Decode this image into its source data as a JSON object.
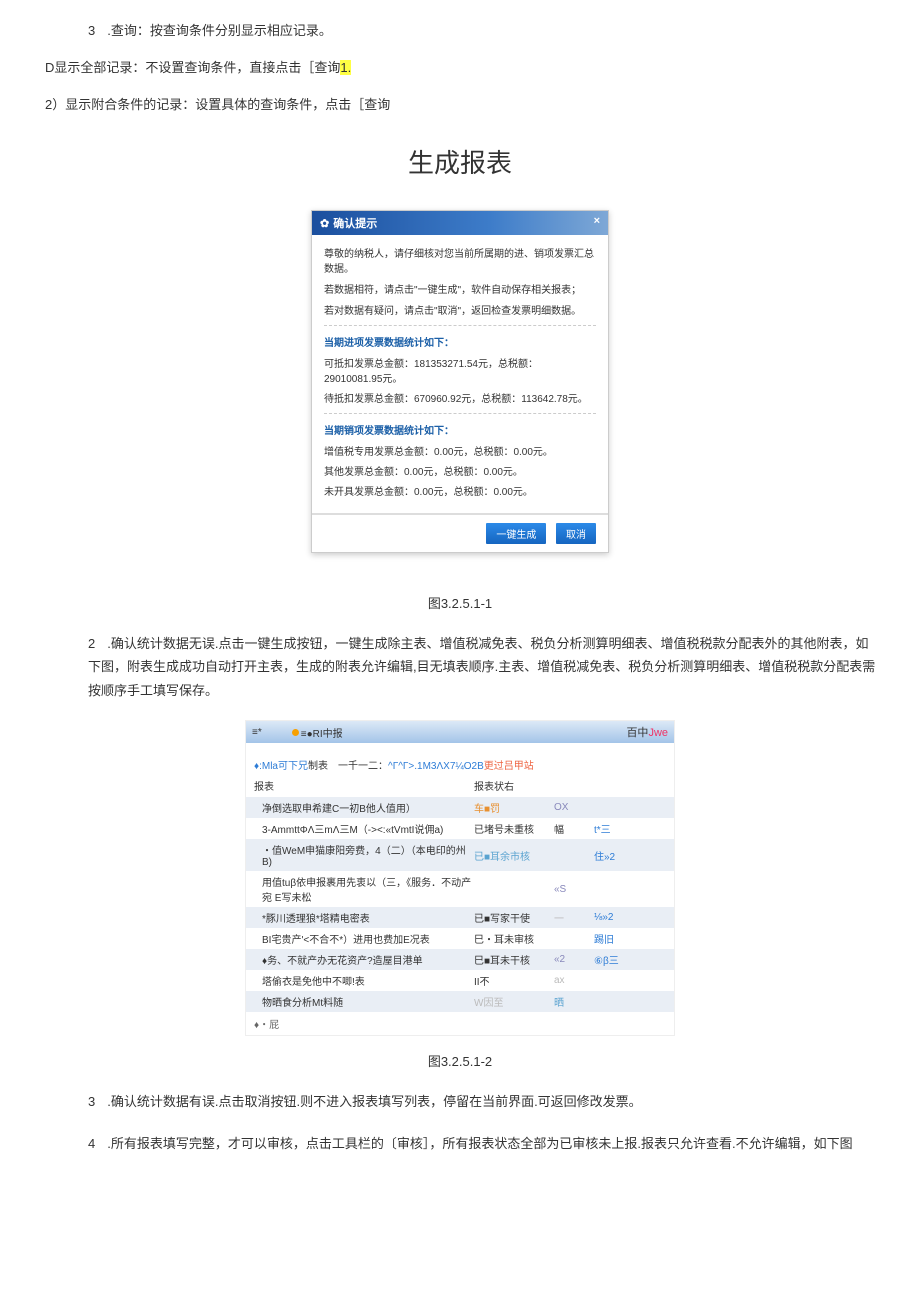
{
  "heading": {
    "item3_no": "3",
    "item3_text": ".查询：按查询条件分别显示相应记录。",
    "subD_a": "D显示全部记录：不设置查询条件，直接点击［查询",
    "subD_hl": "1.",
    "sub2": "2）显示附合条件的记录：设置具体的查询条件，点击［查询"
  },
  "title_gen": "生成报表",
  "dialog": {
    "header_title": "确认提示",
    "header_close": "×",
    "intro1": "尊敬的纳税人，请仔细核对您当前所属期的进、销项发票汇总数据。",
    "intro2": "若数据相符，请点击\"一键生成\"，软件自动保存相关报表；",
    "intro3": "若对数据有疑问，请点击\"取消\"，返回检查发票明细数据。",
    "sec1_h": "当期进项发票数据统计如下：",
    "sec1_l1": "可抵扣发票总金额：181353271.54元，总税额：29010081.95元。",
    "sec1_l2": "待抵扣发票总金额：670960.92元，总税额：113642.78元。",
    "sec2_h": "当期销项发票数据统计如下：",
    "sec2_l1": "增值税专用发票总金额：0.00元，总税额：0.00元。",
    "sec2_l2": "其他发票总金额：0.00元，总税额：0.00元。",
    "sec2_l3": "未开具发票总金额：0.00元，总税额：0.00元。",
    "btn_gen": "一键生成",
    "btn_cancel": "取消"
  },
  "cap1": "图3.2.5.1-1",
  "para2_no": "2",
  "para2_text": ".确认统计数据无误.点击一键生成按钮，一键生成除主表、增值税减免表、税负分析测算明细表、增值税税款分配表外的其他附表，如下图，附表生成成功自动打开主表，生成的附表允许编辑,目无填表顺序.主表、增值税减免表、税负分析测算明细表、增值税税款分配表需按顺序手工填写保存。",
  "table": {
    "header_left": "≡*",
    "header_mid": "≡●RI中报",
    "header_jwe_pre": "百中",
    "header_jwe": "Jwe",
    "sub_a": "♦:Mla可下兄",
    "sub_b": "制表　一千一二：",
    "sub_c": "^Γ^Γ>.1M3ΛX7¼O2B",
    "sub_d": "更过吕甲站",
    "head_c1": "报表",
    "head_c2": "报表状右",
    "rows": [
      {
        "c1": "净倒选取申希建C一初B他人值用）",
        "c2": "车■罚",
        "c2cls": "orange",
        "c3": "OX",
        "c3cls": "violet",
        "c4": "",
        "alt": true
      },
      {
        "c1": "3-AmmttΦΛ三mΛ三M（-><:«tVmtI说佣a)",
        "c2": "已堵号未重核",
        "c3": "幅",
        "c4": "t*三",
        "c4cls": "ltblue"
      },
      {
        "c1": "・值WeM申猫康阳旁费，4（二）（本电印的州B)",
        "c2": "已■耳余市核",
        "c2cls": "ltblue",
        "c3": "",
        "c4": "住»2",
        "c4cls": "teal",
        "alt": true
      },
      {
        "c1": "用值tuβ依申报裹用先衷以（三，《服务．不动产宛 E写未松",
        "c2": "",
        "c3": "«S",
        "c3cls": "violet",
        "c4": ""
      },
      {
        "c1": "*豚川透理狼*塔精电密表",
        "c2": "已■写家干使",
        "c3": "一",
        "c3cls": "gray",
        "c4": "⅛»2",
        "c4cls": "pink",
        "alt": true
      },
      {
        "c1": "BI宅贵产'<不合不*）进用也费加E况表",
        "c2": "巳・耳未审核",
        "c3": "",
        "c4": "踢旧",
        "c4cls": "ltblue"
      },
      {
        "c1": "♦务、不就产办无花资产?造屋目港单",
        "c2": "巳■耳未干核",
        "c3": "«2",
        "c3cls": "violet",
        "c4": "⑥β三",
        "c4cls": "green",
        "alt": true
      },
      {
        "c1": "塔偷衣是免他中不唧!表",
        "c2": "II不",
        "c3": "ax",
        "c3cls": "gray",
        "c4": ""
      },
      {
        "c1": "物晒食分析Mt料随",
        "c2": "W因至",
        "c2cls": "gray",
        "c3": "晒",
        "c3cls": "ltblue",
        "c4": "",
        "alt": true
      }
    ],
    "foot": "♦・屁"
  },
  "cap2": "图3.2.5.1-2",
  "para3_no": "3",
  "para3_text": ".确认统计数据有误.点击取消按钮.则不进入报表填写列表，停留在当前界面.可返回修改发票。",
  "para4_no": "4",
  "para4_text": ".所有报表填写完整，才可以审核，点击工具栏的〔审核］，所有报表状态全部为已审核未上报.报表只允许查看.不允许编辑，如下图"
}
